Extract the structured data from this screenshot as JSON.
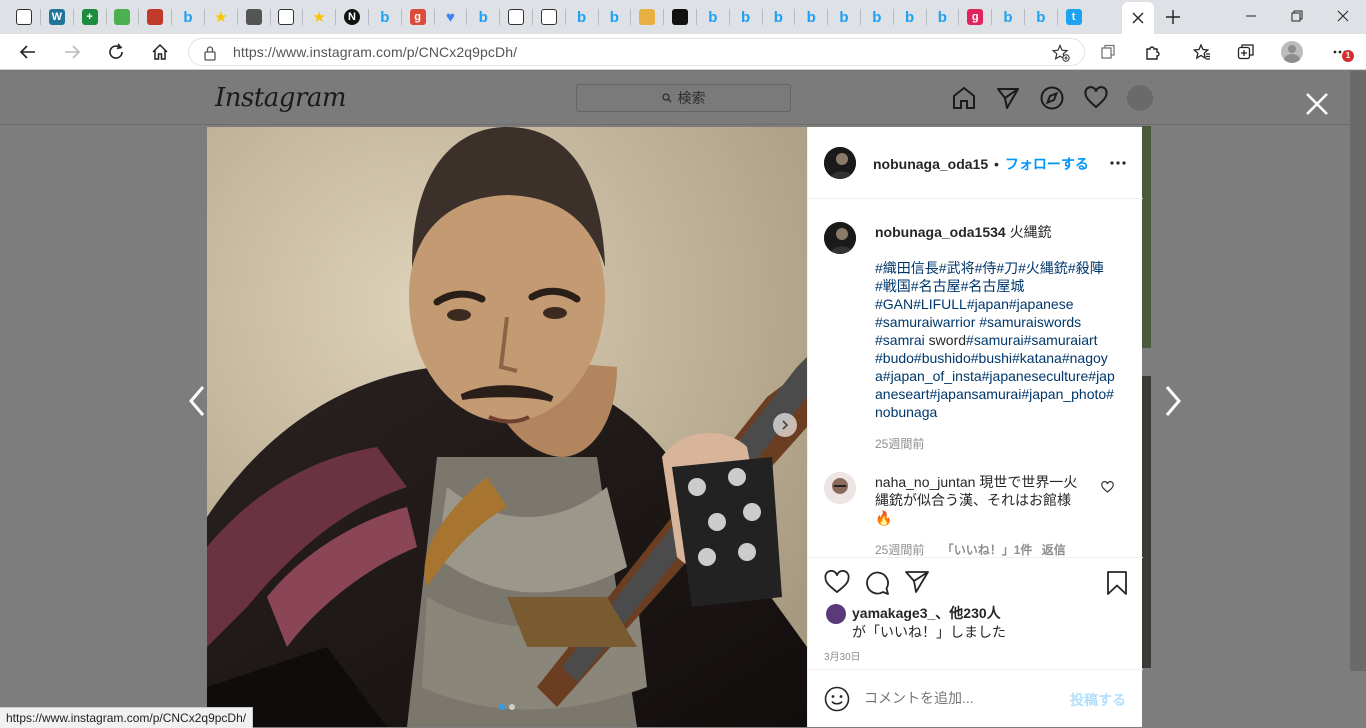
{
  "browser": {
    "tab_favicons": [
      "tab-actions-icon",
      "wordpress-icon",
      "plus-green-icon",
      "bot-icon",
      "avatar-icon",
      "bing-icon",
      "star-icon",
      "logo-icon",
      "page-icon",
      "star-icon",
      "notion-icon",
      "bing-icon",
      "gplus-icon",
      "heart-icon",
      "bing-icon",
      "page-icon",
      "page-icon",
      "bing-icon",
      "bing-icon",
      "frame-icon",
      "bowtie-icon",
      "bing-icon",
      "bing-icon",
      "bing-icon",
      "bing-icon",
      "bing-icon",
      "bing-icon",
      "bing-icon",
      "bing-icon",
      "g-icon",
      "bing-icon",
      "bing-icon",
      "twitter-icon"
    ],
    "url": "https://www.instagram.com/p/CNCx2q9pcDh/",
    "notification_badge": "1",
    "status_url": "https://www.instagram.com/p/CNCx2q9pcDh/"
  },
  "instagram": {
    "logo": "Instagram",
    "search_placeholder": "検索"
  },
  "post": {
    "username": "nobunaga_oda15",
    "follow_label": "フォローする",
    "caption_user": "nobunaga_oda1534",
    "caption_text": "火縄銃",
    "hashtags": [
      "#織田信長#武将#侍#刀#火縄銃#殺陣",
      "#戦国#名古屋#名古屋城",
      "#GAN#LIFULL#japan#japanese",
      "#samuraiwarrior #samuraiswords",
      "#samrai sword#samurai#samuraiart",
      "#budo#bushido#bushi#katana#nagoy",
      "a#japan_of_insta#japaneseculture#jap",
      "aneseart#japansamurai#japan_photo#",
      "nobunaga"
    ],
    "caption_time": "25週間前",
    "comment_user": "naha_no_juntan",
    "comment_lines": [
      "現世で世界一火",
      "縄銃が似合う漢、それはお館様",
      "🔥"
    ],
    "comment_time": "25週間前",
    "comment_likes": "「いいね！」1件",
    "comment_reply": "返信",
    "likes_user": "yamakage3_",
    "likes_rest": "、他230人",
    "likes_suffix": "が「いいね！」しました",
    "post_date": "3月30日",
    "comment_placeholder": "コメントを追加...",
    "post_button": "投稿する"
  }
}
